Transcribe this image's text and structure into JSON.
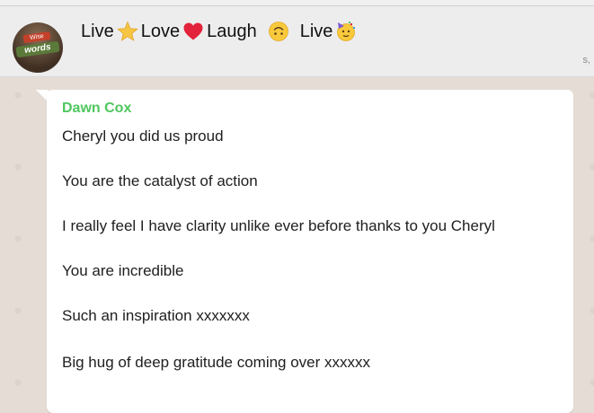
{
  "header": {
    "title_parts": {
      "live1": "Live",
      "love": "Love",
      "laugh": "Laugh",
      "live2": "Live"
    },
    "subtitle": "s,",
    "avatar_text_top": "Wise",
    "avatar_text": "words"
  },
  "icons": [
    "star-icon",
    "heart-icon",
    "upside-down-face-icon",
    "party-face-icon"
  ],
  "colors": {
    "sender": "#4fc75e",
    "header_bg": "#ededed",
    "chat_bg": "#e5ddd5",
    "bubble_bg": "#ffffff"
  },
  "message": {
    "sender": "Dawn Cox",
    "lines": [
      "Cheryl you did us proud",
      "You are the catalyst of action",
      "I really feel I have clarity unlike  ever before thanks to you Cheryl",
      "You are incredible",
      "Such an inspiration xxxxxxx",
      "Big hug of deep gratitude coming over xxxxxx"
    ]
  }
}
